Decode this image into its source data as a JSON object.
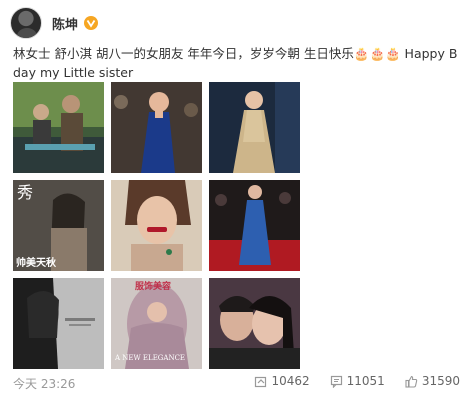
{
  "post": {
    "author": "陈坤",
    "verified_badge": "vip-badge-icon",
    "text": "林女士 舒小淇 胡八一的女朋友 年年今日，岁岁今朝 生日快乐🎂🎂🎂 Happy B day my Little sister",
    "timestamp": "今天 23:26",
    "stats": {
      "reposts": "10462",
      "comments": "11051",
      "likes": "31590"
    }
  },
  "photos": [
    {
      "id": "photo-1",
      "icon": "photo-icon"
    },
    {
      "id": "photo-2",
      "icon": "photo-icon"
    },
    {
      "id": "photo-3",
      "icon": "photo-icon"
    },
    {
      "id": "photo-4",
      "icon": "photo-icon",
      "overlay_text": "秀",
      "caption": "帅美天秋"
    },
    {
      "id": "photo-5",
      "icon": "photo-icon"
    },
    {
      "id": "photo-6",
      "icon": "photo-icon"
    },
    {
      "id": "photo-7",
      "icon": "photo-icon"
    },
    {
      "id": "photo-8",
      "icon": "photo-icon",
      "overlay_text": "服饰美容",
      "caption": "A NEW ELEGANCE"
    },
    {
      "id": "photo-9",
      "icon": "photo-icon"
    }
  ],
  "colors": {
    "link": "#eb7350",
    "vip": "#f6a623",
    "text": "#333333",
    "muted": "#999999"
  }
}
